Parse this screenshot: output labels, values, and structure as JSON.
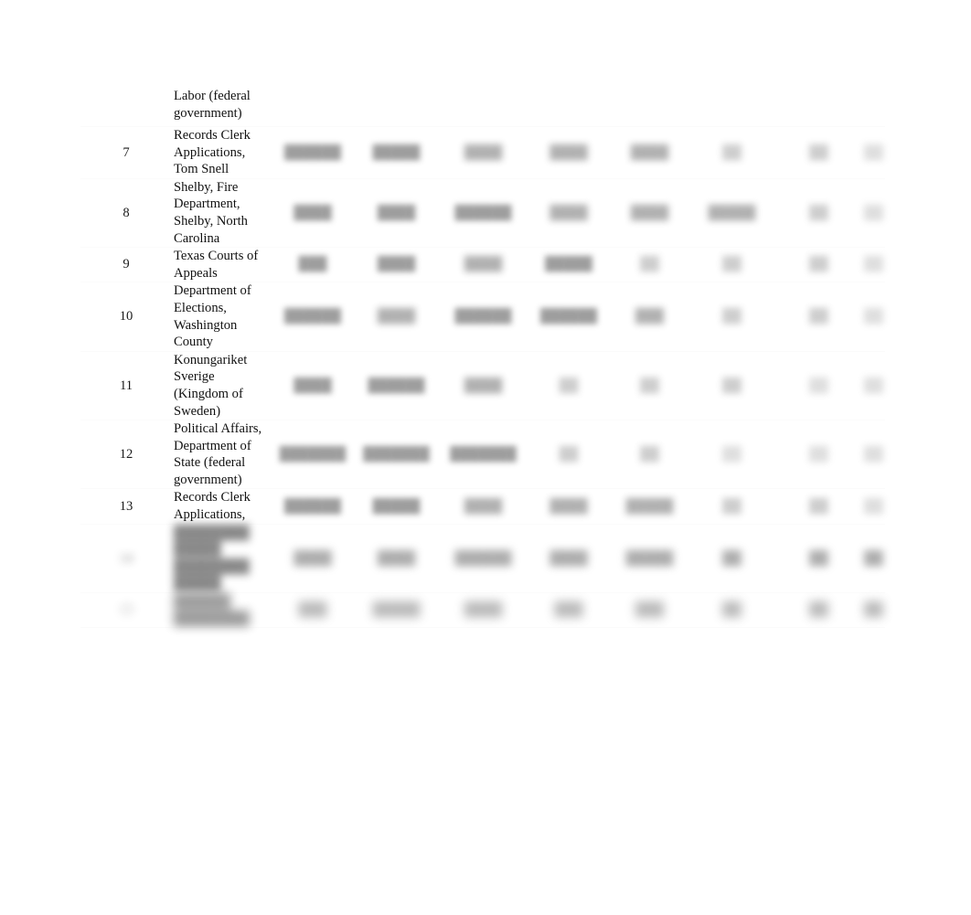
{
  "document": {
    "type": "data-table",
    "continuation_text": "Labor (federal government)",
    "columns": [
      {
        "key": "row_number",
        "label": ""
      },
      {
        "key": "entity_name",
        "label": ""
      },
      {
        "key": "value_1",
        "label": ""
      },
      {
        "key": "value_2",
        "label": ""
      },
      {
        "key": "value_3",
        "label": ""
      },
      {
        "key": "value_4",
        "label": ""
      },
      {
        "key": "value_5",
        "label": ""
      },
      {
        "key": "value_6",
        "label": ""
      },
      {
        "key": "value_7",
        "label": ""
      },
      {
        "key": "value_8",
        "label": ""
      }
    ],
    "rows": [
      {
        "number": "7",
        "name": "Records Clerk Applications, Tom Snell",
        "values": [
          "██████",
          "█████",
          "████",
          "████",
          "████",
          "██",
          "██",
          "██"
        ],
        "obscured": "light"
      },
      {
        "number": "8",
        "name": "Shelby, Fire Department, Shelby, North Carolina",
        "values": [
          "████",
          "████",
          "██████",
          "████",
          "████",
          "█████",
          "██",
          "██"
        ],
        "obscured": "light"
      },
      {
        "number": "9",
        "name": "Texas Courts of Appeals",
        "values": [
          "███",
          "████",
          "████",
          "█████",
          "██",
          "██",
          "██",
          "██"
        ],
        "obscured": "light"
      },
      {
        "number": "10",
        "name": "Department of Elections, Washington County",
        "values": [
          "██████",
          "████",
          "██████",
          "██████",
          "███",
          "██",
          "██",
          "██"
        ],
        "obscured": "light"
      },
      {
        "number": "11",
        "name": "Konungariket Sverige (Kingdom of Sweden)",
        "values": [
          "████",
          "██████",
          "████",
          "██",
          "██",
          "██",
          "██",
          "██"
        ],
        "obscured": "light"
      },
      {
        "number": "12",
        "name": "Political Affairs, Department of State (federal government)",
        "values": [
          "███████",
          "███████",
          "███████",
          "██",
          "██",
          "██",
          "██",
          "██"
        ],
        "obscured": "light"
      },
      {
        "number": "13",
        "name": "Records Clerk Applications,",
        "values": [
          "██████",
          "█████",
          "████",
          "████",
          "█████",
          "██",
          "██",
          "██"
        ],
        "obscured": "light"
      },
      {
        "number": "14",
        "name": "████████ █████ ████████ █████",
        "values": [
          "████",
          "████",
          "██████",
          "████",
          "█████",
          "██",
          "██",
          "██"
        ],
        "obscured": "heavy"
      },
      {
        "number": "15",
        "name": "██████ ████████",
        "values": [
          "███",
          "█████",
          "████",
          "███",
          "███",
          "██",
          "██",
          "██"
        ],
        "obscured": "heavy"
      }
    ]
  }
}
